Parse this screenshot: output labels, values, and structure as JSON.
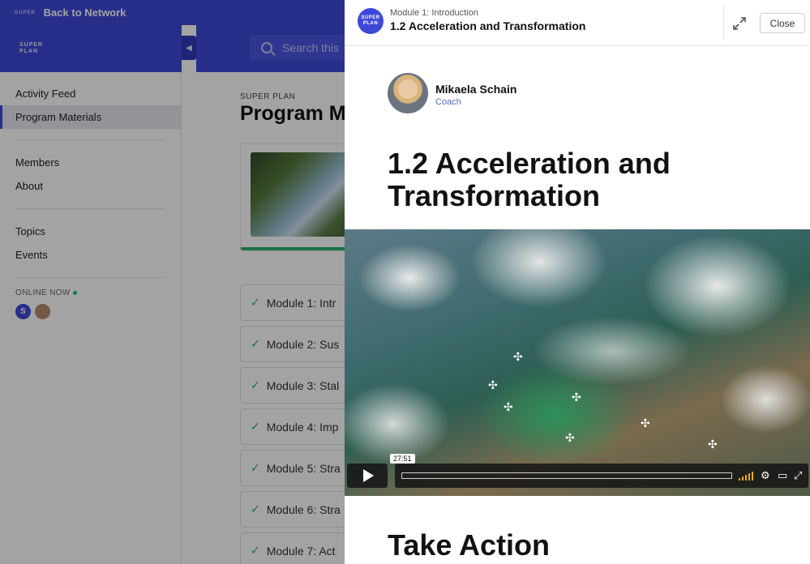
{
  "topbar": {
    "mini_logo": "SUPER",
    "back_label": "Back to Network"
  },
  "brand": {
    "logo_line1": "SUPER",
    "logo_line2": "PLAN"
  },
  "search": {
    "placeholder": "Search this"
  },
  "sidebar": {
    "items_a": [
      {
        "label": "Activity Feed",
        "active": false
      },
      {
        "label": "Program Materials",
        "active": true
      }
    ],
    "items_b": [
      {
        "label": "Members"
      },
      {
        "label": "About"
      }
    ],
    "items_c": [
      {
        "label": "Topics"
      },
      {
        "label": "Events"
      }
    ],
    "online_label": "ONLINE NOW",
    "online_avatars": [
      "S"
    ]
  },
  "main": {
    "eyebrow": "SUPER PLAN",
    "title": "Program M",
    "modules": [
      "Module 1: Intr",
      "Module 2: Sus",
      "Module 3: Stal",
      "Module 4: Imp",
      "Module 5: Stra",
      "Module 6: Stra",
      "Module 7: Act"
    ]
  },
  "panel": {
    "logo_line1": "SUPER",
    "logo_line2": "PLAN",
    "subtitle": "Module 1: Introduction",
    "title": "1.2 Acceleration and Transformation",
    "close_label": "Close",
    "author_name": "Mikaela Schain",
    "author_role": "Coach",
    "lesson_title": "1.2 Acceleration and Transformation",
    "video_time": "27:51",
    "section_heading": "Take Action"
  },
  "colors": {
    "brand": "#3d48d8",
    "success": "#27b36a",
    "volume": "#f0a81a"
  }
}
